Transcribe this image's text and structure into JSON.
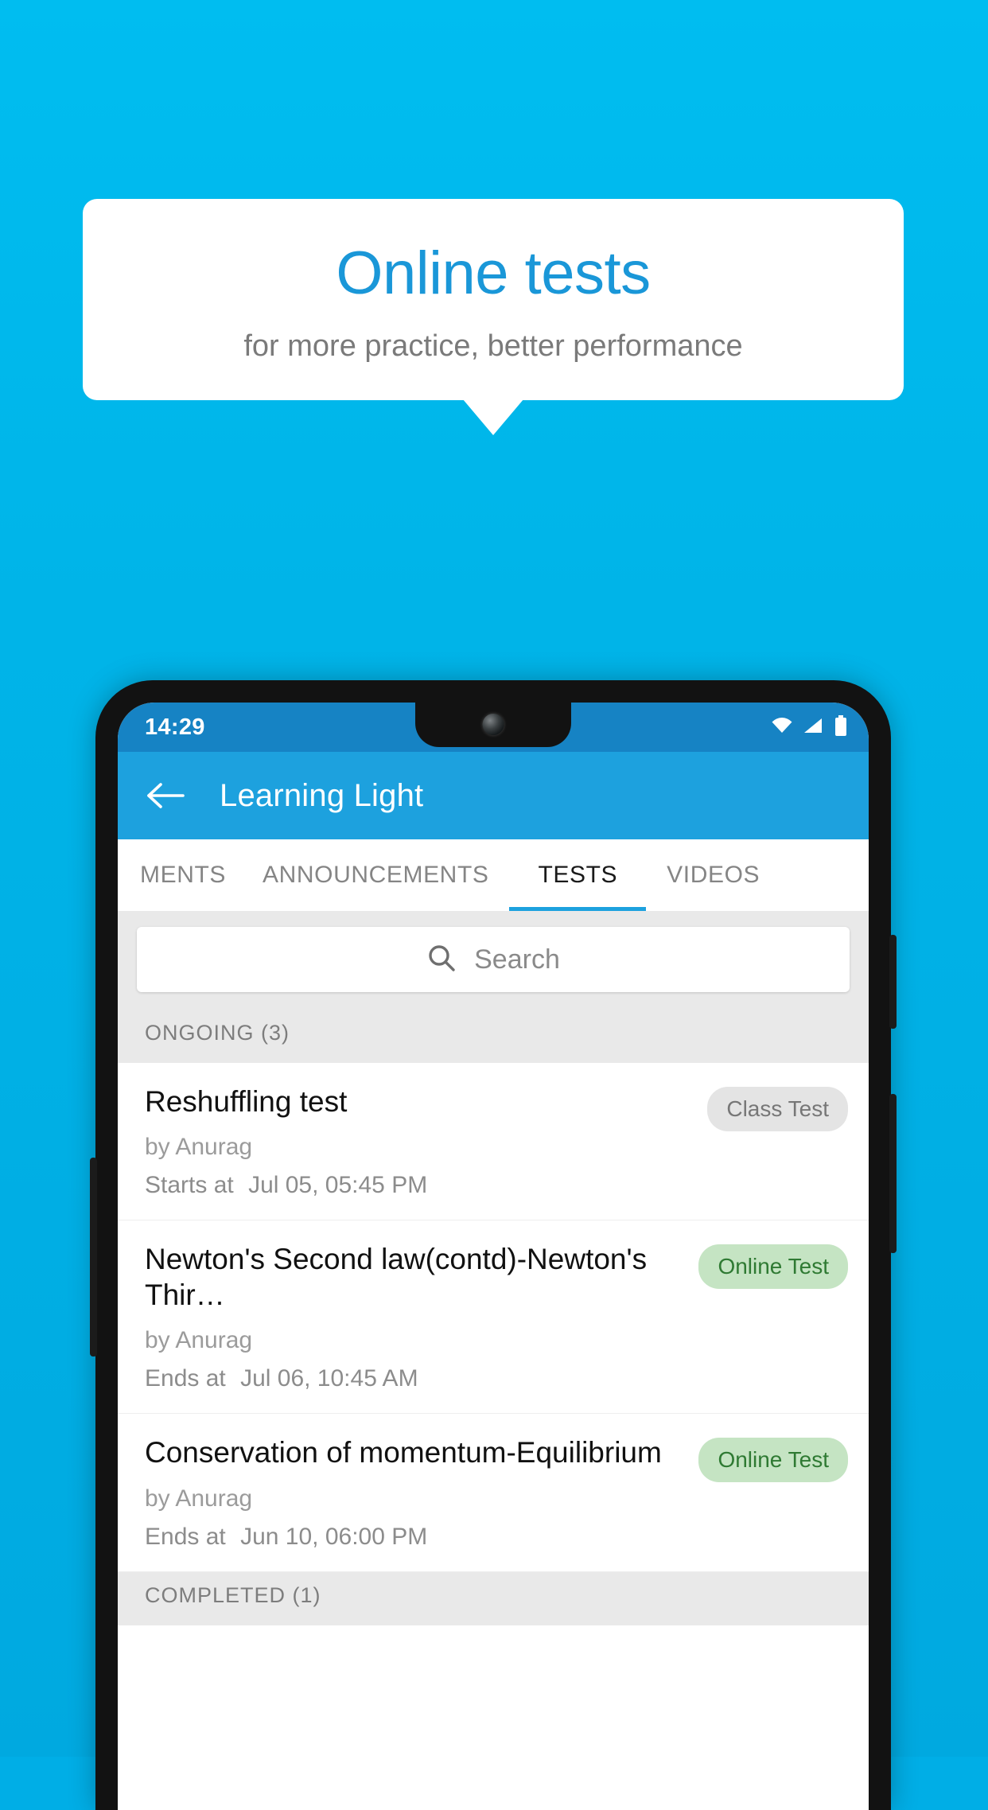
{
  "promo": {
    "title": "Online tests",
    "subtitle": "for more practice, better performance",
    "title_color": "#1A97D8",
    "background_color": "#00B4E8"
  },
  "phone": {
    "statusbar": {
      "time": "14:29",
      "icons": [
        "wifi-icon",
        "signal-icon",
        "battery-icon"
      ]
    },
    "appbar": {
      "back_icon": "back-arrow-icon",
      "title": "Learning Light"
    },
    "tabs": [
      {
        "label": "MENTS",
        "active": false
      },
      {
        "label": "ANNOUNCEMENTS",
        "active": false
      },
      {
        "label": "TESTS",
        "active": true
      },
      {
        "label": "VIDEOS",
        "active": false
      }
    ],
    "search": {
      "icon": "search-icon",
      "placeholder": "Search",
      "value": ""
    },
    "sections": [
      {
        "header": "ONGOING (3)",
        "items": [
          {
            "title": "Reshuffling test",
            "author": "by Anurag",
            "time_label": "Starts at",
            "time_value": "Jul 05, 05:45 PM",
            "badge": "Class Test",
            "badge_type": "gray"
          },
          {
            "title": "Newton's Second law(contd)-Newton's Thir…",
            "author": "by Anurag",
            "time_label": "Ends at",
            "time_value": "Jul 06, 10:45 AM",
            "badge": "Online Test",
            "badge_type": "green"
          },
          {
            "title": "Conservation of momentum-Equilibrium",
            "author": "by Anurag",
            "time_label": "Ends at",
            "time_value": "Jun 10, 06:00 PM",
            "badge": "Online Test",
            "badge_type": "green"
          }
        ]
      },
      {
        "header": "COMPLETED (1)",
        "items": []
      }
    ]
  }
}
